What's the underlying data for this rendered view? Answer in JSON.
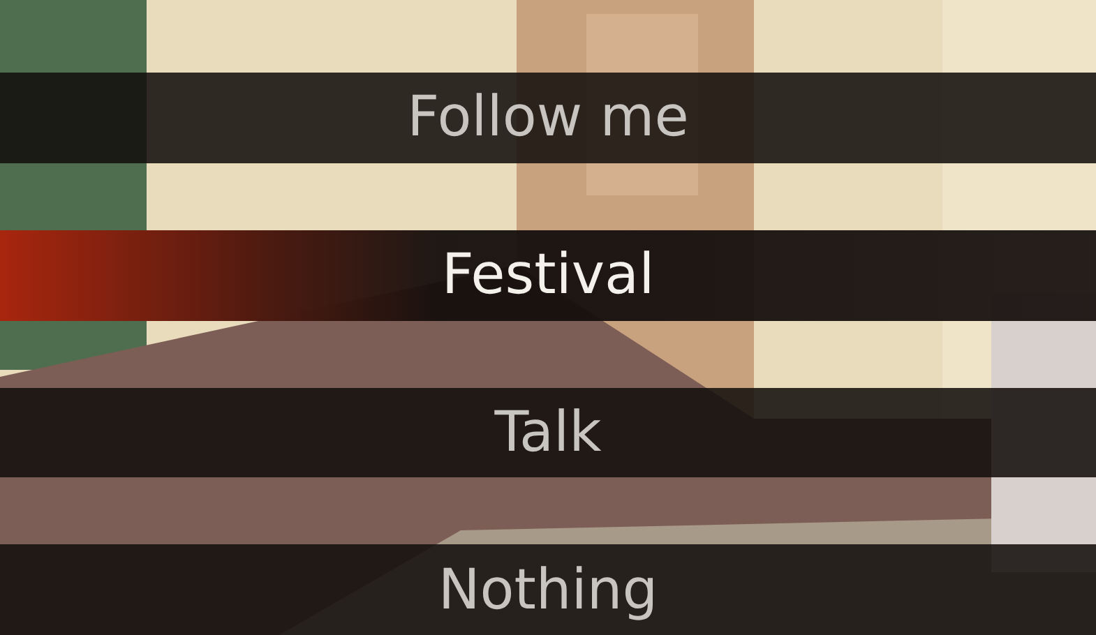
{
  "menu": [
    {
      "label": "Follow me",
      "selected": false
    },
    {
      "label": "Festival",
      "selected": true
    },
    {
      "label": "Talk",
      "selected": false
    },
    {
      "label": "Nothing",
      "selected": false
    }
  ]
}
